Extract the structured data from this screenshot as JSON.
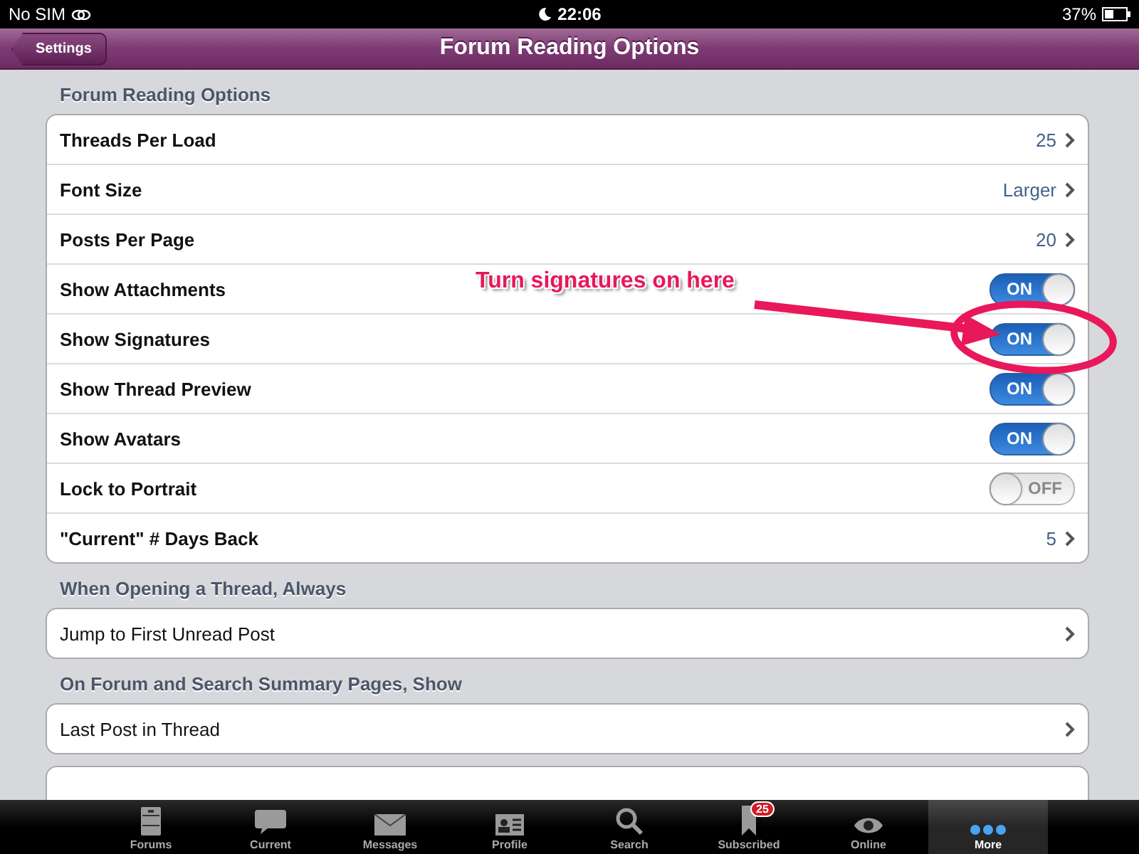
{
  "status_bar": {
    "carrier": "No SIM",
    "time": "22:06",
    "battery": "37%"
  },
  "nav_bar": {
    "back": "Settings",
    "title": "Forum Reading Options"
  },
  "sections": [
    {
      "header": "Forum Reading Options",
      "rows": [
        {
          "kind": "value",
          "label": "Threads Per Load",
          "value": "25"
        },
        {
          "kind": "value",
          "label": "Font Size",
          "value": "Larger"
        },
        {
          "kind": "value",
          "label": "Posts Per Page",
          "value": "20"
        },
        {
          "kind": "toggle",
          "label": "Show Attachments",
          "on": true,
          "state": "ON"
        },
        {
          "kind": "toggle",
          "label": "Show Signatures",
          "on": true,
          "state": "ON"
        },
        {
          "kind": "toggle",
          "label": "Show Thread Preview",
          "on": true,
          "state": "ON"
        },
        {
          "kind": "toggle",
          "label": "Show Avatars",
          "on": true,
          "state": "ON"
        },
        {
          "kind": "toggle",
          "label": "Lock to Portrait",
          "on": false,
          "state": "OFF"
        },
        {
          "kind": "value",
          "label": "\"Current\" # Days Back",
          "value": "5"
        }
      ]
    },
    {
      "header": "When Opening a Thread, Always",
      "rows": [
        {
          "kind": "link",
          "label": "Jump to First Unread Post"
        }
      ]
    },
    {
      "header": "On Forum and Search Summary Pages, Show",
      "rows": [
        {
          "kind": "link",
          "label": "Last Post in Thread"
        }
      ]
    }
  ],
  "annotation": {
    "text": "Turn signatures on here"
  },
  "tab_bar": [
    {
      "kind": "cabinet",
      "label": "Forums",
      "selected": false
    },
    {
      "kind": "bubble",
      "label": "Current",
      "selected": false
    },
    {
      "kind": "envelope",
      "label": "Messages",
      "selected": false
    },
    {
      "kind": "card",
      "label": "Profile",
      "selected": false
    },
    {
      "kind": "search",
      "label": "Search",
      "selected": false
    },
    {
      "kind": "bookmark",
      "label": "Subscribed",
      "selected": false,
      "badge": "25"
    },
    {
      "kind": "eye",
      "label": "Online",
      "selected": false
    },
    {
      "kind": "dots",
      "label": "More",
      "selected": true
    }
  ]
}
